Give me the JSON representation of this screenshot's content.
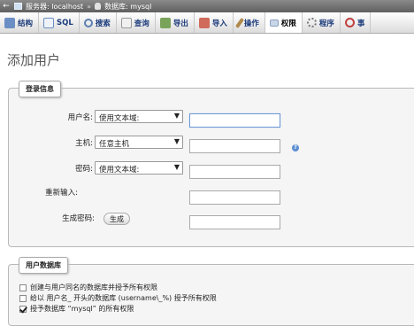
{
  "breadcrumb": {
    "server": "服务器: localhost",
    "separator": "»",
    "database": "数据库: mysql"
  },
  "tabs": [
    {
      "label": "结构",
      "icon": "structure-icon"
    },
    {
      "label": "SQL",
      "icon": "sql-icon"
    },
    {
      "label": "搜索",
      "icon": "search-icon"
    },
    {
      "label": "查询",
      "icon": "query-icon"
    },
    {
      "label": "导出",
      "icon": "export-icon"
    },
    {
      "label": "导入",
      "icon": "import-icon"
    },
    {
      "label": "操作",
      "icon": "wrench-icon"
    },
    {
      "label": "权限",
      "icon": "privileges-icon"
    },
    {
      "label": "程序",
      "icon": "routines-icon"
    },
    {
      "label": "事",
      "icon": "events-icon"
    }
  ],
  "page_title": "添加用户",
  "login": {
    "legend": "登录信息",
    "username_label": "用户名:",
    "username_select": "使用文本域:",
    "host_label": "主机:",
    "host_select": "任意主机",
    "password_label": "密码:",
    "password_select": "使用文本域:",
    "reenter_label": "重新输入:",
    "generate_label": "生成密码:",
    "generate_button": "生成"
  },
  "database": {
    "legend": "用户数据库",
    "options": [
      {
        "label": "创建与用户同名的数据库并授予所有权限",
        "checked": false
      },
      {
        "label": "给以 用户名_ 开头的数据库 (username\\_%) 授予所有权限",
        "checked": false
      },
      {
        "label": "授予数据库 “mysql” 的所有权限",
        "checked": true
      }
    ]
  }
}
